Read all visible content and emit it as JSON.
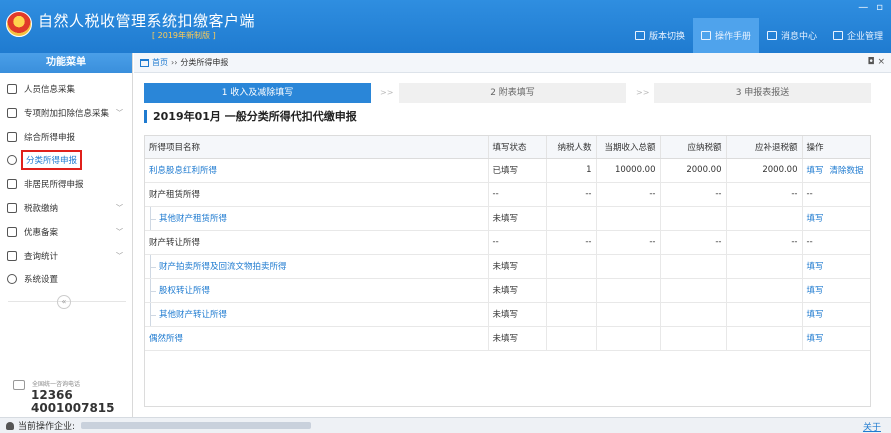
{
  "header": {
    "title": "自然人税收管理系统扣缴客户端",
    "subtitle": "[ 2019年新制版 ]",
    "nav": [
      {
        "label": "版本切换",
        "icon": "version-icon"
      },
      {
        "label": "操作手册",
        "icon": "manual-icon"
      },
      {
        "label": "消息中心",
        "icon": "mail-icon"
      },
      {
        "label": "企业管理",
        "icon": "company-icon"
      }
    ],
    "win_min": "—",
    "win_restore": "▫"
  },
  "sidebar": {
    "title": "功能菜单",
    "items": [
      {
        "label": "人员信息采集",
        "icon": "person-icon",
        "arrow": ""
      },
      {
        "label": "专项附加扣除信息采集",
        "icon": "list-icon",
        "arrow": "﹀"
      },
      {
        "label": "综合所得申报",
        "icon": "layers-icon",
        "arrow": ""
      },
      {
        "label": "分类所得申报",
        "icon": "clock-icon",
        "arrow": ""
      },
      {
        "label": "非居民所得申报",
        "icon": "person-outline-icon",
        "arrow": ""
      },
      {
        "label": "税款缴纳",
        "icon": "folder-icon",
        "arrow": "﹀"
      },
      {
        "label": "优惠备案",
        "icon": "document-icon",
        "arrow": "﹀"
      },
      {
        "label": "查询统计",
        "icon": "search-icon",
        "arrow": "﹀"
      },
      {
        "label": "系统设置",
        "icon": "gear-icon",
        "arrow": ""
      }
    ],
    "collapse": "«",
    "hotline_label": "全国统一咨询电话",
    "hotline1": "12366",
    "hotline2": "4001007815"
  },
  "breadcrumb": {
    "home": "首页",
    "sep": "››",
    "current": "分类所得申报",
    "close": "◘ ×"
  },
  "steps": [
    "1 收入及减除填写",
    "2 附表填写",
    "3 申报表报送"
  ],
  "step_arrow": ">>",
  "section_title": "2019年01月  一般分类所得代扣代缴申报",
  "table": {
    "headers": [
      "所得项目名称",
      "填写状态",
      "纳税人数",
      "当期收入总额",
      "应纳税额",
      "应补退税额",
      "操作"
    ],
    "rows": [
      {
        "name": "利息股息红利所得",
        "kind": "link",
        "status": "已填写",
        "count": "1",
        "income": "10000.00",
        "tax": "2000.00",
        "refund": "2000.00",
        "ops": [
          "填写",
          "清除数据"
        ]
      },
      {
        "name": "财产租赁所得",
        "kind": "group",
        "status": "--",
        "count": "--",
        "income": "--",
        "tax": "--",
        "refund": "--",
        "ops_text": "--"
      },
      {
        "name": "其他财产租赁所得",
        "kind": "sub",
        "status": "未填写",
        "count": "",
        "income": "",
        "tax": "",
        "refund": "",
        "ops": [
          "填写"
        ]
      },
      {
        "name": "财产转让所得",
        "kind": "group",
        "status": "--",
        "count": "--",
        "income": "--",
        "tax": "--",
        "refund": "--",
        "ops_text": "--"
      },
      {
        "name": "财产拍卖所得及回流文物拍卖所得",
        "kind": "sub",
        "status": "未填写",
        "count": "",
        "income": "",
        "tax": "",
        "refund": "",
        "ops": [
          "填写"
        ]
      },
      {
        "name": "股权转让所得",
        "kind": "sub",
        "status": "未填写",
        "count": "",
        "income": "",
        "tax": "",
        "refund": "",
        "ops": [
          "填写"
        ]
      },
      {
        "name": "其他财产转让所得",
        "kind": "sub",
        "status": "未填写",
        "count": "",
        "income": "",
        "tax": "",
        "refund": "",
        "ops": [
          "填写"
        ]
      },
      {
        "name": "偶然所得",
        "kind": "link",
        "status": "未填写",
        "count": "",
        "income": "",
        "tax": "",
        "refund": "",
        "ops": [
          "填写"
        ]
      }
    ]
  },
  "status_bar": {
    "label": "当前操作企业:",
    "about": "关于"
  }
}
